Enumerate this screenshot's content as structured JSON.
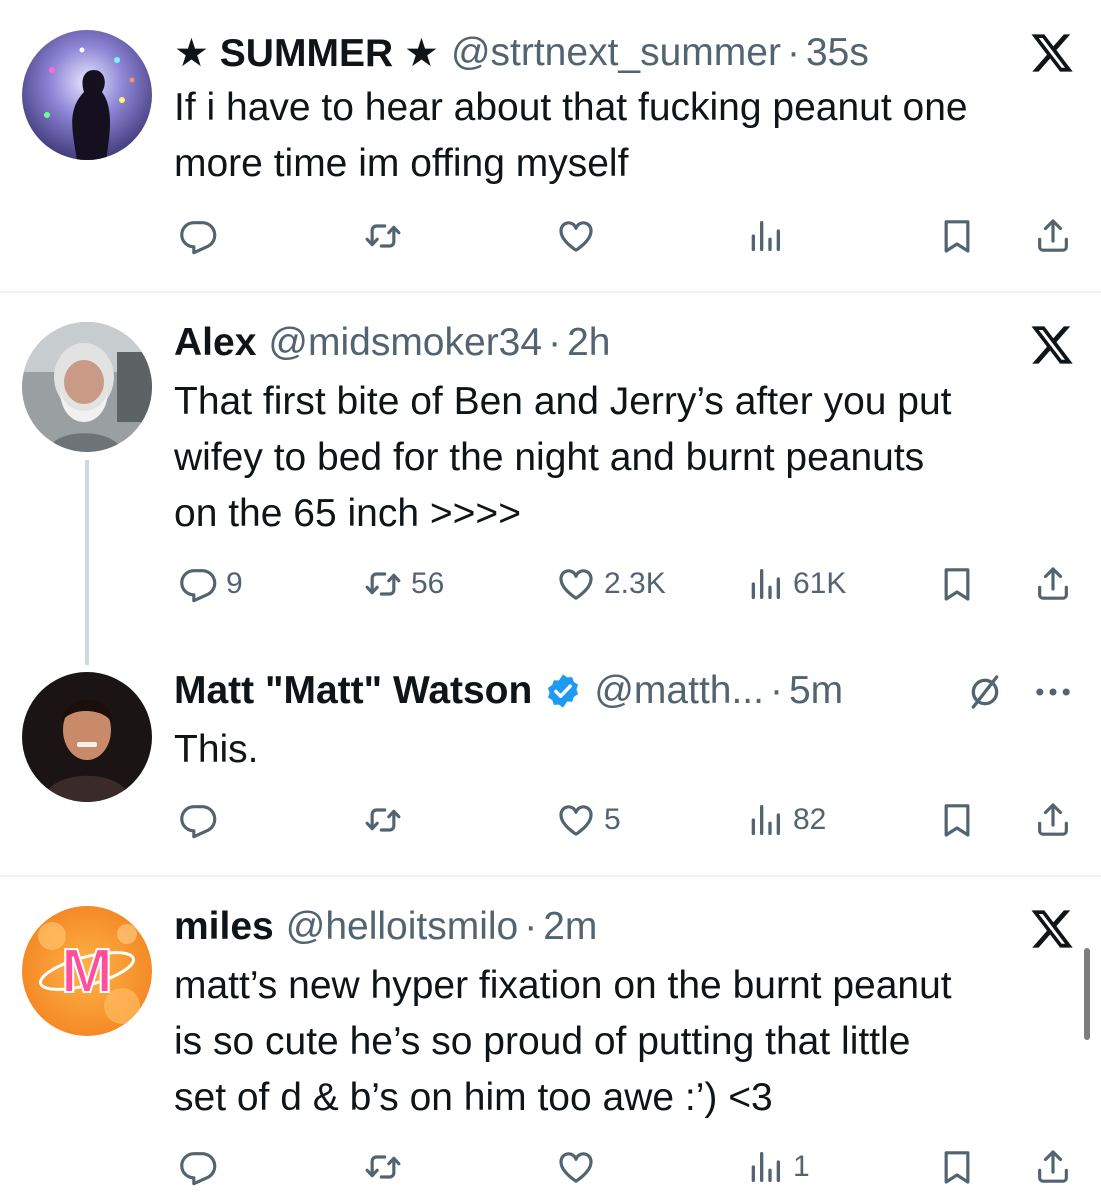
{
  "colors": {
    "text": "#0f1419",
    "secondary": "#536471",
    "divider": "#eff3f4",
    "verified": "#1d9bf0"
  },
  "tweets": [
    {
      "name": "★ SUMMER ★",
      "handle": "@strtnext_summer",
      "dot": "·",
      "time": "35s",
      "lines": [
        "If i have to hear about that fucking peanut one",
        "more time im offing myself"
      ],
      "stats": {
        "replies": "",
        "retweets": "",
        "likes": "",
        "views": ""
      }
    },
    {
      "name": "Alex",
      "handle": "@midsmoker34",
      "dot": "·",
      "time": "2h",
      "lines": [
        "That first bite of Ben and Jerry’s after you put",
        "wifey to bed for the night and burnt peanuts",
        "on the 65 inch >>>>"
      ],
      "stats": {
        "replies": "9",
        "retweets": "56",
        "likes": "2.3K",
        "views": "61K"
      }
    },
    {
      "name": "Matt \"Matt\" Watson",
      "handle": "@matth...",
      "dot": "·",
      "time": "5m",
      "lines": [
        "This."
      ],
      "stats": {
        "replies": "",
        "retweets": "",
        "likes": "5",
        "views": "82"
      }
    },
    {
      "name": "miles",
      "handle": "@helloitsmilo",
      "dot": "·",
      "time": "2m",
      "lines": [
        "matt’s new hyper fixation on the burnt peanut",
        "is so cute he’s so proud of putting that little",
        "set of d & b’s on him too awe :’) <3"
      ],
      "stats": {
        "replies": "",
        "retweets": "",
        "likes": "",
        "views": "1"
      }
    }
  ],
  "icons": [
    "x-logo-icon",
    "reply-icon",
    "retweet-icon",
    "like-icon",
    "views-icon",
    "bookmark-icon",
    "share-icon",
    "verified-icon",
    "mute-icon",
    "more-icon"
  ]
}
